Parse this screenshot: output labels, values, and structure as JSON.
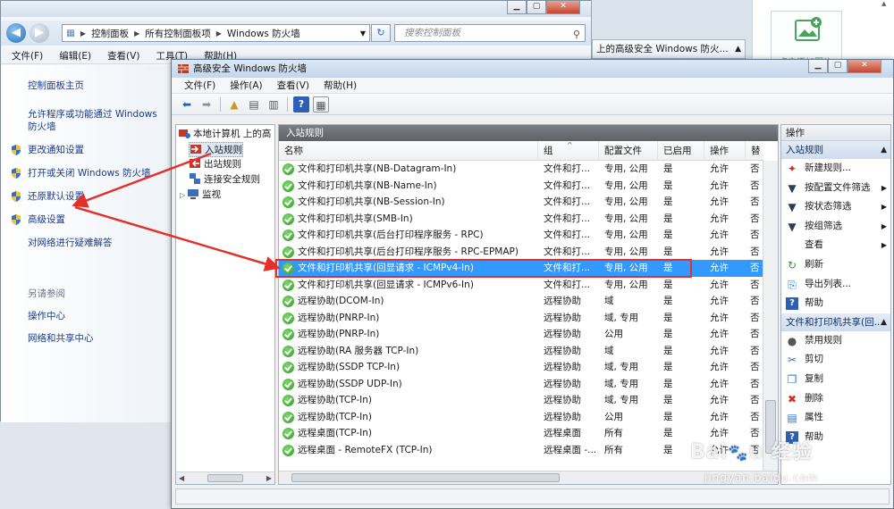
{
  "control_panel": {
    "breadcrumb": [
      "控制面板",
      "所有控制面板项",
      "Windows 防火墙"
    ],
    "search_placeholder": "搜索控制面板",
    "menu": [
      "文件(F)",
      "编辑(E)",
      "查看(V)",
      "工具(T)",
      "帮助(H)"
    ],
    "left_links": [
      {
        "label": "控制面板主页",
        "icon": "none"
      },
      {
        "label": "允许程序或功能通过 Windows 防火墙",
        "icon": "none"
      },
      {
        "label": "更改通知设置",
        "icon": "shield-icon"
      },
      {
        "label": "打开或关闭 Windows 防火墙",
        "icon": "shield-icon"
      },
      {
        "label": "还原默认设置",
        "icon": "shield-icon"
      },
      {
        "label": "高级设置",
        "icon": "shield-icon"
      },
      {
        "label": "对网络进行疑难解答",
        "icon": "none"
      }
    ],
    "see_also_title": "另请参阅",
    "see_also": [
      "操作中心",
      "网络和共享中心"
    ]
  },
  "right_window": {
    "header": "上的高级安全 Windows 防火..."
  },
  "photo_panel": {
    "label": "点击添加图片"
  },
  "wf": {
    "title": "高级安全 Windows 防火墙",
    "menu": [
      "文件(F)",
      "操作(A)",
      "查看(V)",
      "帮助(H)"
    ],
    "tree": {
      "root": "本地计算机 上的高",
      "items": [
        "入站规则",
        "出站规则",
        "连接安全规则",
        "监视"
      ]
    },
    "center_title": "入站规则",
    "columns": [
      "名称",
      "组",
      "配置文件",
      "已启用",
      "操作",
      "替"
    ],
    "rows": [
      {
        "name": "文件和打印机共享(NB-Datagram-In)",
        "group": "文件和打...",
        "profile": "专用, 公用",
        "enabled": "是",
        "action": "允许",
        "override": "否"
      },
      {
        "name": "文件和打印机共享(NB-Name-In)",
        "group": "文件和打...",
        "profile": "专用, 公用",
        "enabled": "是",
        "action": "允许",
        "override": "否"
      },
      {
        "name": "文件和打印机共享(NB-Session-In)",
        "group": "文件和打...",
        "profile": "专用, 公用",
        "enabled": "是",
        "action": "允许",
        "override": "否"
      },
      {
        "name": "文件和打印机共享(SMB-In)",
        "group": "文件和打...",
        "profile": "专用, 公用",
        "enabled": "是",
        "action": "允许",
        "override": "否"
      },
      {
        "name": "文件和打印机共享(后台打印程序服务 - RPC)",
        "group": "文件和打...",
        "profile": "专用, 公用",
        "enabled": "是",
        "action": "允许",
        "override": "否"
      },
      {
        "name": "文件和打印机共享(后台打印程序服务 - RPC-EPMAP)",
        "group": "文件和打...",
        "profile": "专用, 公用",
        "enabled": "是",
        "action": "允许",
        "override": "否"
      },
      {
        "name": "文件和打印机共享(回显请求 - ICMPv4-In)",
        "group": "文件和打...",
        "profile": "专用, 公用",
        "enabled": "是",
        "action": "允许",
        "override": "否"
      },
      {
        "name": "文件和打印机共享(回显请求 - ICMPv6-In)",
        "group": "文件和打...",
        "profile": "专用, 公用",
        "enabled": "是",
        "action": "允许",
        "override": "否"
      },
      {
        "name": "远程协助(DCOM-In)",
        "group": "远程协助",
        "profile": "域",
        "enabled": "是",
        "action": "允许",
        "override": "否"
      },
      {
        "name": "远程协助(PNRP-In)",
        "group": "远程协助",
        "profile": "域, 专用",
        "enabled": "是",
        "action": "允许",
        "override": "否"
      },
      {
        "name": "远程协助(PNRP-In)",
        "group": "远程协助",
        "profile": "公用",
        "enabled": "是",
        "action": "允许",
        "override": "否"
      },
      {
        "name": "远程协助(RA 服务器 TCP-In)",
        "group": "远程协助",
        "profile": "域",
        "enabled": "是",
        "action": "允许",
        "override": "否"
      },
      {
        "name": "远程协助(SSDP TCP-In)",
        "group": "远程协助",
        "profile": "域, 专用",
        "enabled": "是",
        "action": "允许",
        "override": "否"
      },
      {
        "name": "远程协助(SSDP UDP-In)",
        "group": "远程协助",
        "profile": "域, 专用",
        "enabled": "是",
        "action": "允许",
        "override": "否"
      },
      {
        "name": "远程协助(TCP-In)",
        "group": "远程协助",
        "profile": "域, 专用",
        "enabled": "是",
        "action": "允许",
        "override": "否"
      },
      {
        "name": "远程协助(TCP-In)",
        "group": "远程协助",
        "profile": "公用",
        "enabled": "是",
        "action": "允许",
        "override": "否"
      },
      {
        "name": "远程桌面(TCP-In)",
        "group": "远程桌面",
        "profile": "所有",
        "enabled": "是",
        "action": "允许",
        "override": "否"
      },
      {
        "name": "远程桌面 - RemoteFX (TCP-In)",
        "group": "远程桌面 -...",
        "profile": "所有",
        "enabled": "是",
        "action": "允许",
        "override": "否"
      }
    ],
    "selected_row": 6,
    "actions": {
      "header": "操作",
      "section1": "入站规则",
      "items1": [
        {
          "label": "新建规则...",
          "icon": "new-rule-icon"
        },
        {
          "label": "按配置文件筛选",
          "icon": "filter-icon",
          "submenu": true
        },
        {
          "label": "按状态筛选",
          "icon": "filter-icon",
          "submenu": true
        },
        {
          "label": "按组筛选",
          "icon": "filter-icon",
          "submenu": true
        },
        {
          "label": "查看",
          "icon": "none",
          "submenu": true
        },
        {
          "label": "刷新",
          "icon": "refresh-icon"
        },
        {
          "label": "导出列表...",
          "icon": "export-icon"
        },
        {
          "label": "帮助",
          "icon": "help-icon"
        }
      ],
      "section2": "文件和打印机共享(回...",
      "items2": [
        {
          "label": "禁用规则",
          "icon": "disable-icon"
        },
        {
          "label": "剪切",
          "icon": "cut-icon"
        },
        {
          "label": "复制",
          "icon": "copy-icon"
        },
        {
          "label": "删除",
          "icon": "delete-icon"
        },
        {
          "label": "属性",
          "icon": "properties-icon"
        },
        {
          "label": "帮助",
          "icon": "help-icon"
        }
      ]
    }
  },
  "colors": {
    "highlight": "#3399ff",
    "annotation": "#e2302b",
    "link": "#1a3b8c"
  },
  "watermark": {
    "url": "jingyan.baidu.com"
  }
}
